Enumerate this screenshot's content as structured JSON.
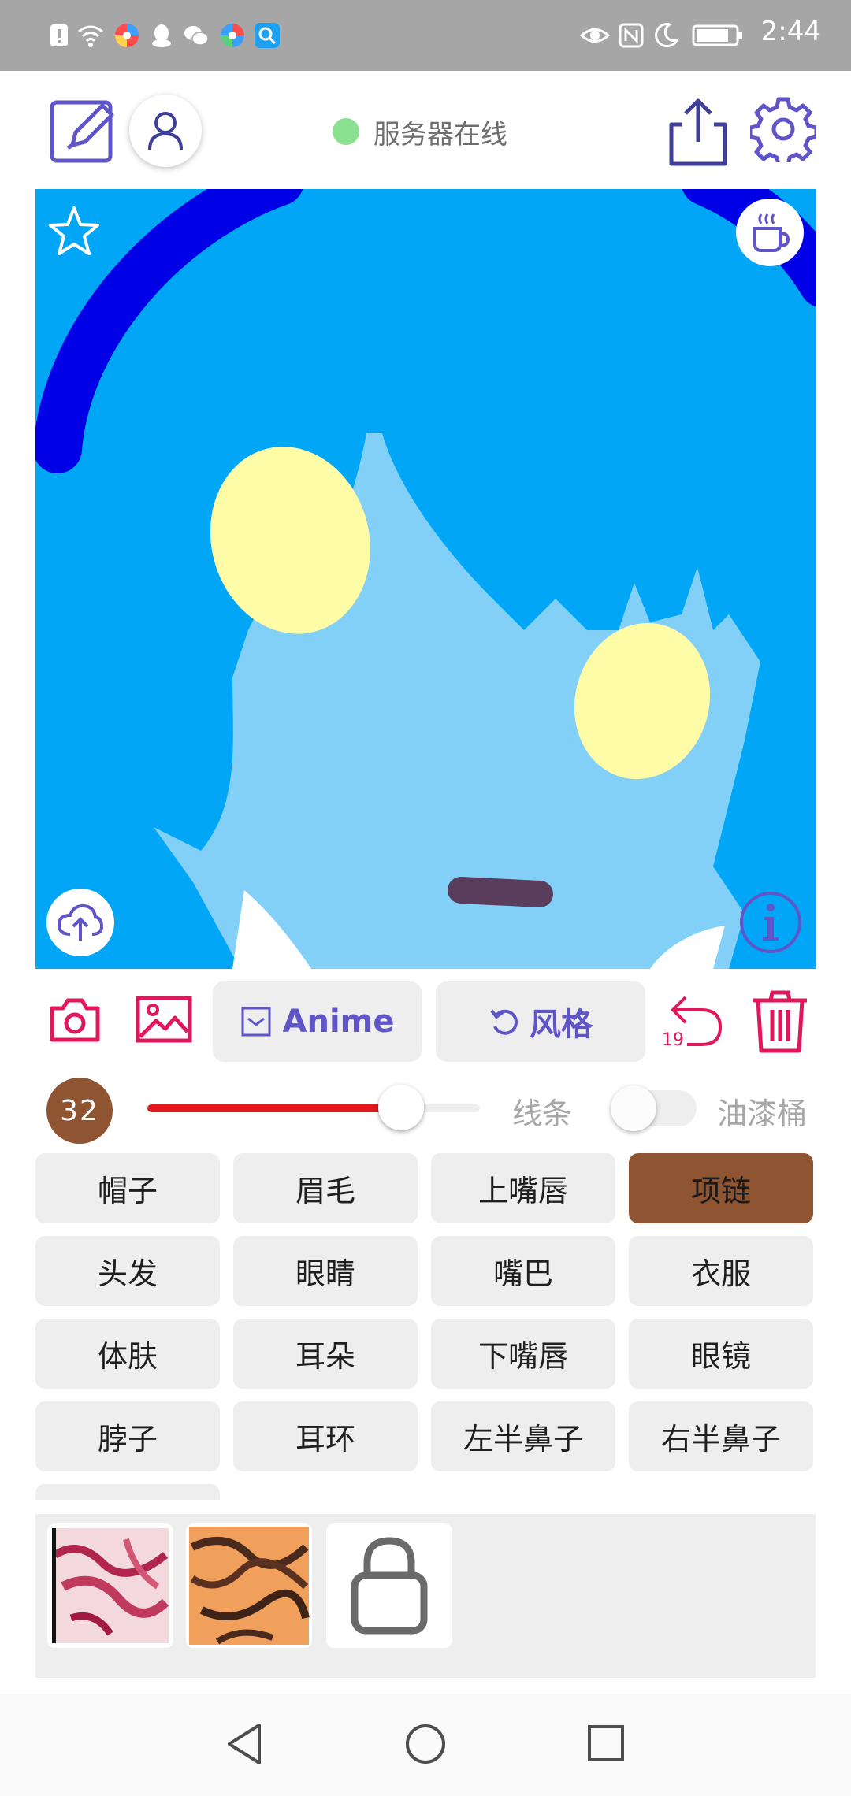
{
  "status_bar": {
    "time": "2:44",
    "left_icons": [
      "sim-alert-icon",
      "wifi-icon",
      "app-icon",
      "qq-icon",
      "wechat-icon",
      "app-icon",
      "search-app-icon"
    ],
    "right_icons": [
      "eye-icon",
      "nfc-icon",
      "moon-icon",
      "battery-icon"
    ]
  },
  "top_bar": {
    "server_status": "服务器在线",
    "server_status_color": "#8be08f",
    "icons": [
      "edit-icon",
      "user-icon",
      "share-icon",
      "settings-icon"
    ]
  },
  "canvas": {
    "background": "#01a6f6",
    "icons": [
      "star-icon",
      "coffee-icon",
      "cloud-upload-icon",
      "info-icon"
    ]
  },
  "toolbar": {
    "anime_label": "Anime",
    "style_label": "风格",
    "undo_count": "19",
    "accent_color": "#5f55c9",
    "danger_color": "#e0185a"
  },
  "brush": {
    "size": "32",
    "slider_fraction": 0.77,
    "line_label": "线条",
    "bucket_label": "油漆桶",
    "bucket_enabled": false
  },
  "labels": [
    {
      "text": "帽子",
      "selected": false
    },
    {
      "text": "眉毛",
      "selected": false
    },
    {
      "text": "上嘴唇",
      "selected": false
    },
    {
      "text": "项链",
      "selected": true
    },
    {
      "text": "头发",
      "selected": false
    },
    {
      "text": "眼睛",
      "selected": false
    },
    {
      "text": "嘴巴",
      "selected": false
    },
    {
      "text": "衣服",
      "selected": false
    },
    {
      "text": "体肤",
      "selected": false
    },
    {
      "text": "耳朵",
      "selected": false
    },
    {
      "text": "下嘴唇",
      "selected": false
    },
    {
      "text": "眼镜",
      "selected": false
    },
    {
      "text": "脖子",
      "selected": false
    },
    {
      "text": "耳环",
      "selected": false
    },
    {
      "text": "左半鼻子",
      "selected": false
    },
    {
      "text": "右半鼻子",
      "selected": false
    }
  ],
  "styles_tray": {
    "items": [
      "style-thumbnail-red",
      "style-thumbnail-orange",
      "lock-icon"
    ]
  },
  "nav_bar": {
    "icons": [
      "back-icon",
      "home-icon",
      "recents-icon"
    ]
  }
}
